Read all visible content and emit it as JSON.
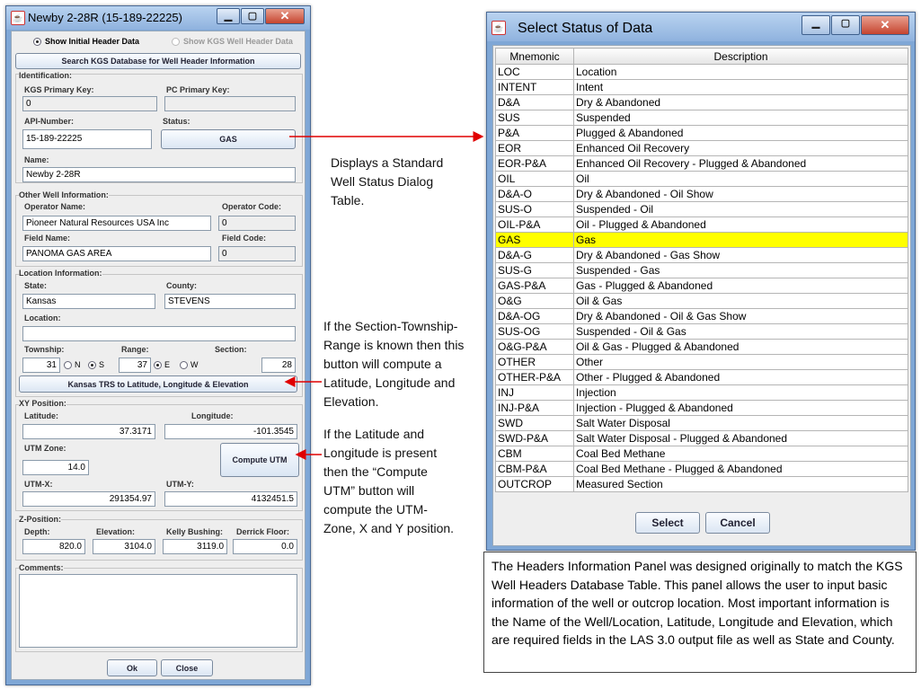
{
  "header_window": {
    "title": "Newby 2-28R (15-189-22225)",
    "radio_initial": "Show Initial Header Data",
    "radio_kgs": "Show KGS Well Header Data",
    "search_button": "Search KGS Database for Well Header Information",
    "identification": {
      "label": "Identification:",
      "kgs_key_label": "KGS Primary Key:",
      "kgs_key": "0",
      "pc_key_label": "PC Primary Key:",
      "pc_key": "",
      "api_label": "API-Number:",
      "api": "15-189-22225",
      "status_label": "Status:",
      "status_button": "GAS",
      "name_label": "Name:",
      "name": "Newby 2-28R"
    },
    "other": {
      "label": "Other Well Information:",
      "operator_name_label": "Operator Name:",
      "operator_name": "Pioneer Natural Resources USA Inc",
      "operator_code_label": "Operator Code:",
      "operator_code": "0",
      "field_name_label": "Field Name:",
      "field_name": "PANOMA GAS AREA",
      "field_code_label": "Field Code:",
      "field_code": "0"
    },
    "location": {
      "label": "Location Information:",
      "state_label": "State:",
      "state": "Kansas",
      "county_label": "County:",
      "county": "STEVENS",
      "location_label": "Location:",
      "location": "",
      "township_label": "Township:",
      "township": "31",
      "n": "N",
      "s": "S",
      "range_label": "Range:",
      "range": "37",
      "e": "E",
      "w": "W",
      "section_label": "Section:",
      "section": "28",
      "trs_button": "Kansas TRS to Latitude, Longitude & Elevation"
    },
    "xy": {
      "label": "XY Position:",
      "lat_label": "Latitude:",
      "lat": "37.3171",
      "lon_label": "Longitude:",
      "lon": "-101.3545",
      "zone_label": "UTM Zone:",
      "zone": "14.0",
      "compute_button": "Compute UTM",
      "utmx_label": "UTM-X:",
      "utmx": "291354.97",
      "utmy_label": "UTM-Y:",
      "utmy": "4132451.5"
    },
    "z": {
      "label": "Z-Position:",
      "depth_label": "Depth:",
      "depth": "820.0",
      "elev_label": "Elevation:",
      "elev": "3104.0",
      "kb_label": "Kelly Bushing:",
      "kb": "3119.0",
      "df_label": "Derrick Floor:",
      "df": "0.0"
    },
    "comments_label": "Comments:",
    "ok_button": "Ok",
    "close_button": "Close"
  },
  "status_window": {
    "title": "Select Status of Data",
    "col_mnemonic": "Mnemonic",
    "col_description": "Description",
    "rows": [
      [
        "LOC",
        "Location"
      ],
      [
        "INTENT",
        "Intent"
      ],
      [
        "D&A",
        "Dry & Abandoned"
      ],
      [
        "SUS",
        "Suspended"
      ],
      [
        "P&A",
        "Plugged & Abandoned"
      ],
      [
        "EOR",
        "Enhanced Oil Recovery"
      ],
      [
        "EOR-P&A",
        "Enhanced Oil Recovery - Plugged & Abandoned"
      ],
      [
        "OIL",
        "Oil"
      ],
      [
        "D&A-O",
        "Dry & Abandoned - Oil Show"
      ],
      [
        "SUS-O",
        "Suspended - Oil"
      ],
      [
        "OIL-P&A",
        "Oil - Plugged & Abandoned"
      ],
      [
        "GAS",
        "Gas"
      ],
      [
        "D&A-G",
        "Dry & Abandoned - Gas Show"
      ],
      [
        "SUS-G",
        "Suspended - Gas"
      ],
      [
        "GAS-P&A",
        "Gas - Plugged & Abandoned"
      ],
      [
        "O&G",
        "Oil & Gas"
      ],
      [
        "D&A-OG",
        "Dry & Abandoned - Oil & Gas Show"
      ],
      [
        "SUS-OG",
        "Suspended - Oil & Gas"
      ],
      [
        "O&G-P&A",
        "Oil & Gas - Plugged & Abandoned"
      ],
      [
        "OTHER",
        "Other"
      ],
      [
        "OTHER-P&A",
        "Other - Plugged & Abandoned"
      ],
      [
        "INJ",
        "Injection"
      ],
      [
        "INJ-P&A",
        "Injection - Plugged & Abandoned"
      ],
      [
        "SWD",
        "Salt Water Disposal"
      ],
      [
        "SWD-P&A",
        "Salt Water Disposal - Plugged & Abandoned"
      ],
      [
        "CBM",
        "Coal Bed Methane"
      ],
      [
        "CBM-P&A",
        "Coal Bed Methane - Plugged & Abandoned"
      ],
      [
        "OUTCROP",
        "Measured Section"
      ]
    ],
    "selected_mnemonic": "GAS",
    "select_button": "Select",
    "cancel_button": "Cancel"
  },
  "annotations": {
    "status_note": "Displays a Standard Well Status Dialog Table.",
    "trs_note": "If the Section-Township-Range is known then this button will compute a Latitude, Longitude and Elevation.",
    "utm_note": "If the Latitude and Longitude is present then the “Compute UTM” button will compute the UTM-Zone, X and Y position.",
    "summary": "The Headers Information Panel was designed originally to match the KGS Well Headers Database Table.  This panel allows the user to input basic information of the well or outcrop location. Most important information is the Name of the Well/Location, Latitude, Longitude and Elevation, which are required fields in the LAS 3.0 output file as well as State and County."
  },
  "colors": {
    "highlight": "#ffff00",
    "arrow": "#e00000",
    "titlebar": "#9bbce3"
  }
}
